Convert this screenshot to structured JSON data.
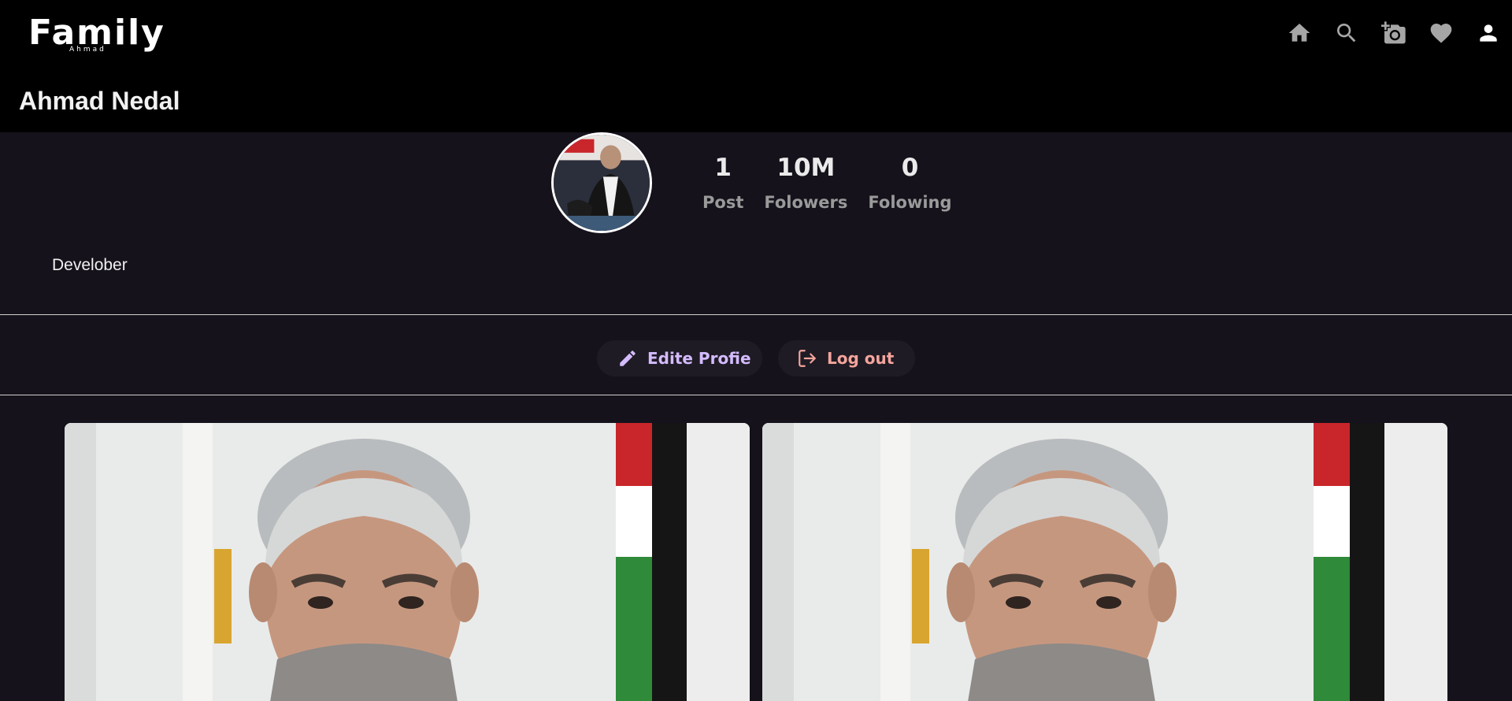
{
  "app": {
    "logo": "Family",
    "logo_sub": "Ahmad"
  },
  "nav": [
    {
      "name": "home-icon"
    },
    {
      "name": "search-icon"
    },
    {
      "name": "add-photo-icon"
    },
    {
      "name": "heart-icon"
    },
    {
      "name": "person-icon"
    }
  ],
  "profile": {
    "username": "Ahmad Nedal",
    "bio": "Develober",
    "stats": {
      "posts": {
        "value": "1",
        "label": "Post"
      },
      "followers": {
        "value": "10M",
        "label": "Folowers"
      },
      "following": {
        "value": "0",
        "label": "Folowing"
      }
    }
  },
  "actions": {
    "edit_label": "Edite Profie",
    "logout_label": "Log out"
  },
  "colors": {
    "background": "#15121b",
    "header": "#000000",
    "edit_accent": "#d4bbff",
    "logout_accent": "#f4a59c",
    "icon_gray": "#a6a6a6"
  }
}
